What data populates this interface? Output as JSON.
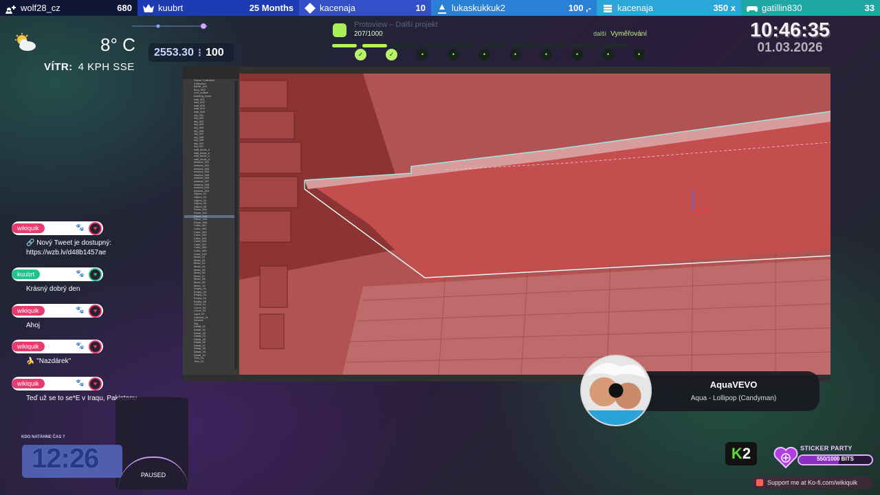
{
  "alert_bar": [
    {
      "icon": "user-plus-icon",
      "name": "wolf28_cz",
      "value": "680",
      "bg": "#101736"
    },
    {
      "icon": "crown-icon",
      "name": "kuubrt",
      "value": "25 Months",
      "bg": "#1d3bb3"
    },
    {
      "icon": "diamond-icon",
      "name": "kacenaja",
      "value": "10",
      "bg": "#3450c8"
    },
    {
      "icon": "tip-icon",
      "name": "lukaskukkuk2",
      "value": "100 ,-",
      "bg": "#2a7fd6"
    },
    {
      "icon": "stack-icon",
      "name": "kacenaja",
      "value": "350 x",
      "bg": "#2aa6d8"
    },
    {
      "icon": "controller-icon",
      "name": "gatillin830",
      "value": "33",
      "bg": "#1fa7a3"
    }
  ],
  "weather": {
    "icon": "partly-cloudy-icon",
    "temperature": "8° C",
    "wind_label": "VÍTR:",
    "wind_value": "4 KPH SSE"
  },
  "bits_counter": {
    "current": "2553.30",
    "separator": "⁝",
    "goal": "100"
  },
  "progress": {
    "icon": "coffee-cup-icon",
    "title_faint": "Protoview – Další projekt",
    "value": "207/1000",
    "fraction": 0.207,
    "next_label": "další",
    "next_value": "Vyměřování",
    "steps": [
      {
        "icon": "pencil-icon",
        "done": true
      },
      {
        "icon": "pen-icon",
        "done": true
      },
      {
        "icon": "close-icon",
        "done": false
      },
      {
        "icon": "hammer-icon",
        "done": false
      },
      {
        "icon": "wrench-icon",
        "done": false
      },
      {
        "icon": "shield-icon",
        "done": false
      },
      {
        "icon": "question-icon",
        "done": false
      },
      {
        "icon": "home-icon",
        "done": false
      },
      {
        "icon": "bookmark-icon",
        "done": false
      },
      {
        "icon": "cup-icon",
        "done": false
      }
    ]
  },
  "clock": {
    "time": "10:46:35",
    "date": "01.03.2026"
  },
  "chat": [
    {
      "user": "wikiquik",
      "color": "#e83a6e",
      "line1": "🔗 Nový Tweet je dostupný:",
      "line2": "https://wzb.lv/d48b1457ae"
    },
    {
      "user": "kuubrt",
      "color": "#1fc48a",
      "line1": "Krásný dobrý den",
      "line2": ""
    },
    {
      "user": "wikiquik",
      "color": "#e83a6e",
      "line1": "Ahoj",
      "line2": ""
    },
    {
      "user": "wikiquik",
      "color": "#e83a6e",
      "line1": "🍌 \"Nazdárek\"",
      "line2": ""
    },
    {
      "user": "wikiquik",
      "color": "#e83a6e",
      "line1": "Teď už se to se*E v Iraqu, Pakistanu",
      "line2": ""
    }
  ],
  "timer": {
    "label": "KDO NATÁHNE ČAS ?",
    "value": "12:26"
  },
  "paused": {
    "label": "PAUSED"
  },
  "now_playing": {
    "artist": "AquaVEVO",
    "song": "Aqua - Lollipop (Candyman)"
  },
  "k2_logo": {
    "k": "K",
    "two": "2"
  },
  "sticker_party": {
    "title": "STICKER PARTY",
    "value": "550/1000 BITS",
    "fraction": 0.55
  },
  "kofi": {
    "text": "Support me at Ko-fi.com/wikiquik"
  },
  "blender": {
    "outliner_items": [
      "Scene Collection",
      "Collection",
      "BASE_001",
      "floor_002",
      "roof_outline",
      "building_block",
      "wall_001",
      "wall_002",
      "wall_003",
      "wall_004",
      "wall_005",
      "obj_001",
      "obj_002",
      "obj_003",
      "obj_004",
      "obj_005",
      "obj_006",
      "obj_007",
      "obj_008",
      "obj_009",
      "obj_010",
      "obj_011",
      "wall_block_a",
      "wall_block_b",
      "wall_block_c",
      "wall_block_d",
      "window_001",
      "window_002",
      "window_003",
      "window_004",
      "window_005",
      "window_006",
      "window_007",
      "window_008",
      "window_009",
      "window_010",
      "Object_01",
      "Object_02",
      "Object_03",
      "Object_04",
      "Object_05",
      "Plane_001",
      "Plane_002",
      "Plane_003",
      "Plane_004",
      "Plane_005",
      "Cube_001",
      "Cube_002",
      "Cube_003",
      "Cube_004",
      "Cube_005",
      "Cube_006",
      "Cube_007",
      "Cube_008",
      "Cube_009",
      "Cube_010",
      "Mesh_01",
      "Mesh_02",
      "Mesh_03",
      "Mesh_04",
      "Mesh_05",
      "Mesh_06",
      "Mesh_07",
      "Mesh_08",
      "Mesh_09",
      "Mesh_10",
      "Empty_01",
      "Empty_02",
      "Empty_03",
      "Empty_04",
      "Empty_05",
      "Curve_01",
      "Curve_02",
      "Curve_03",
      "Light_01",
      "Camera_01",
      "Ground",
      "Sky",
      "Detail_01",
      "Detail_02",
      "Detail_03",
      "Detail_04",
      "Detail_05",
      "Detail_06",
      "Detail_07",
      "Detail_08",
      "Detail_09",
      "Detail_10",
      "Trim_01",
      "Trim_02"
    ]
  }
}
